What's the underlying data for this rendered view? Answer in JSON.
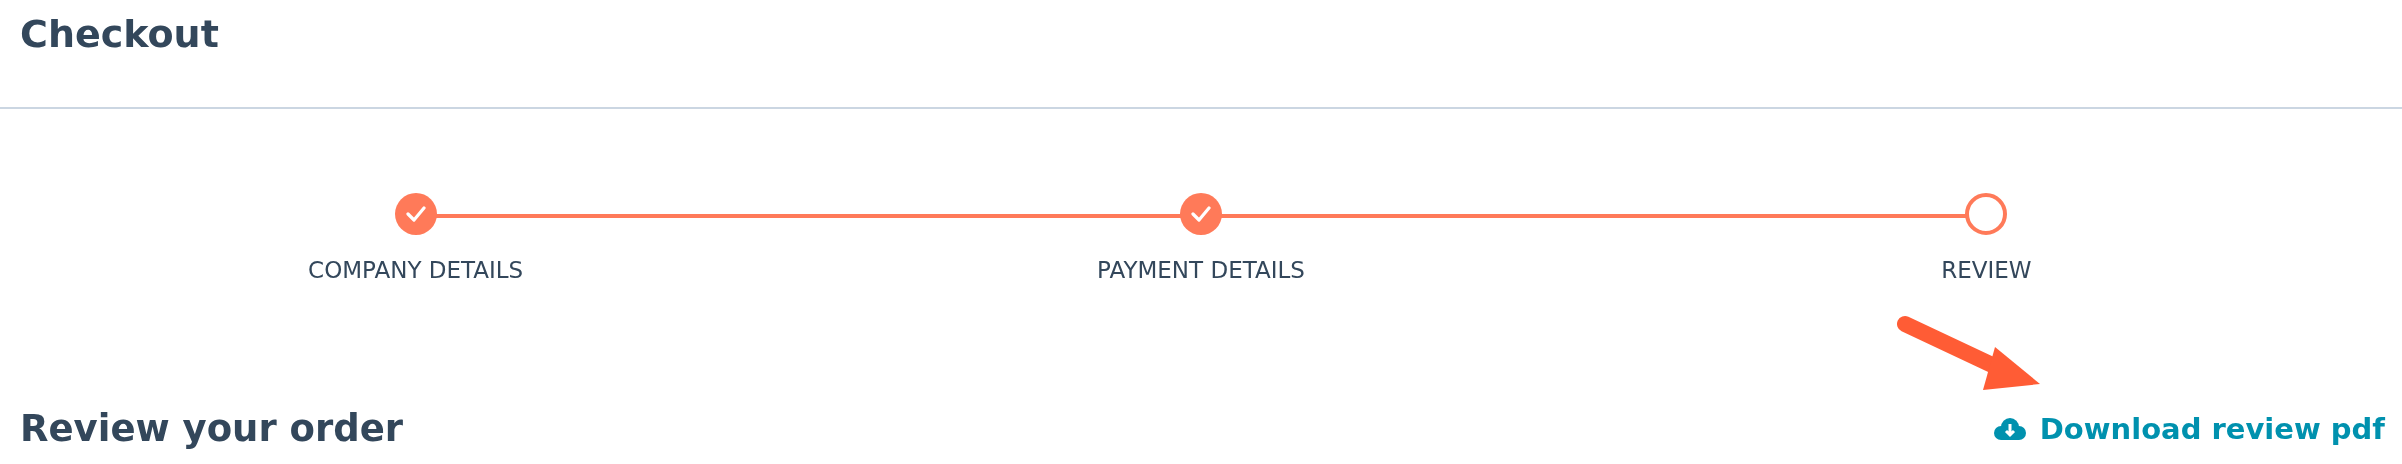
{
  "header": {
    "title": "Checkout"
  },
  "steps": [
    {
      "label": "COMPANY DETAILS",
      "completed": true
    },
    {
      "label": "PAYMENT DETAILS",
      "completed": true
    },
    {
      "label": "REVIEW",
      "completed": false
    }
  ],
  "review": {
    "title": "Review your order",
    "download_link": "Download review pdf"
  }
}
